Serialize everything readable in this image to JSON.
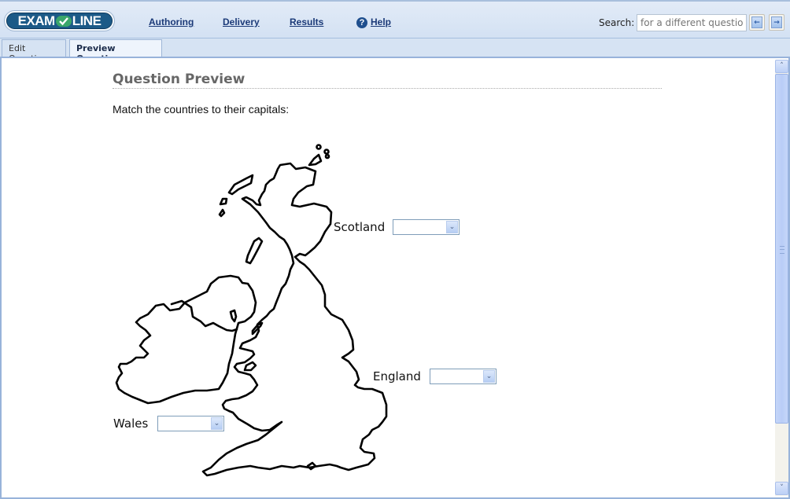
{
  "app": {
    "logo_left": "EXAM",
    "logo_right": "LINE"
  },
  "nav": {
    "items": [
      {
        "label": "Authoring"
      },
      {
        "label": "Delivery"
      },
      {
        "label": "Results"
      },
      {
        "label": "Help",
        "icon": "help-icon"
      }
    ],
    "help_glyph": "?"
  },
  "search": {
    "label": "Search:",
    "placeholder": "for a different question",
    "prev_glyph": "←",
    "next_glyph": "→"
  },
  "tabs": [
    {
      "label": "Edit Question",
      "active": false
    },
    {
      "label": "Preview Question",
      "active": true
    }
  ],
  "main": {
    "title": "Question Preview",
    "instructions": "Match the countries to their capitals:",
    "matches": [
      {
        "country": "Scotland",
        "selected": ""
      },
      {
        "country": "England",
        "selected": ""
      },
      {
        "country": "Wales",
        "selected": ""
      }
    ],
    "dropdown_glyph": "⌄"
  },
  "scrollbar": {
    "up_glyph": "˄",
    "down_glyph": "˅"
  },
  "colors": {
    "accent": "#1b3a78",
    "logo_blue": "#1c5a87",
    "logo_green": "#3aa66a",
    "header_bg": "#d6e3f3"
  }
}
